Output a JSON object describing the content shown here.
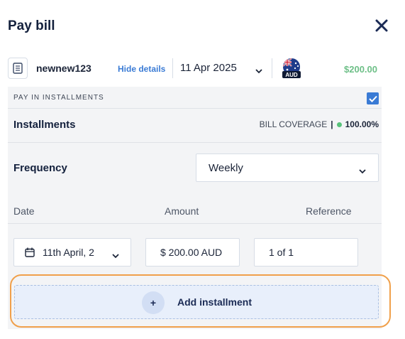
{
  "header": {
    "title": "Pay bill",
    "close_icon": "close-icon"
  },
  "bill": {
    "icon": "document-icon",
    "name": "newnew123",
    "hide_details_label": "Hide details",
    "date_value": "11 Apr 2025",
    "currency_code": "AUD",
    "currency_icon": "australia-flag-icon",
    "total_amount": "$200.00",
    "total_amount_color": "#6dbf87"
  },
  "installments": {
    "section_label": "PAY IN INSTALLMENTS",
    "enabled": true,
    "heading": "Installments",
    "coverage_label": "BILL COVERAGE",
    "coverage_separator": "|",
    "coverage_value": "100.00%",
    "coverage_dot_color": "#57c27a",
    "frequency_label": "Frequency",
    "frequency_value": "Weekly",
    "columns": {
      "date": "Date",
      "amount": "Amount",
      "reference": "Reference"
    },
    "rows": [
      {
        "date": "11th April, 2",
        "amount": "$ 200.00 AUD",
        "reference": "1 of 1"
      }
    ],
    "add_button_label": "Add installment",
    "add_button_icon": "+"
  },
  "colors": {
    "accent": "#3a7bd5",
    "highlight_outline": "#f0a04b",
    "title": "#14213d"
  }
}
